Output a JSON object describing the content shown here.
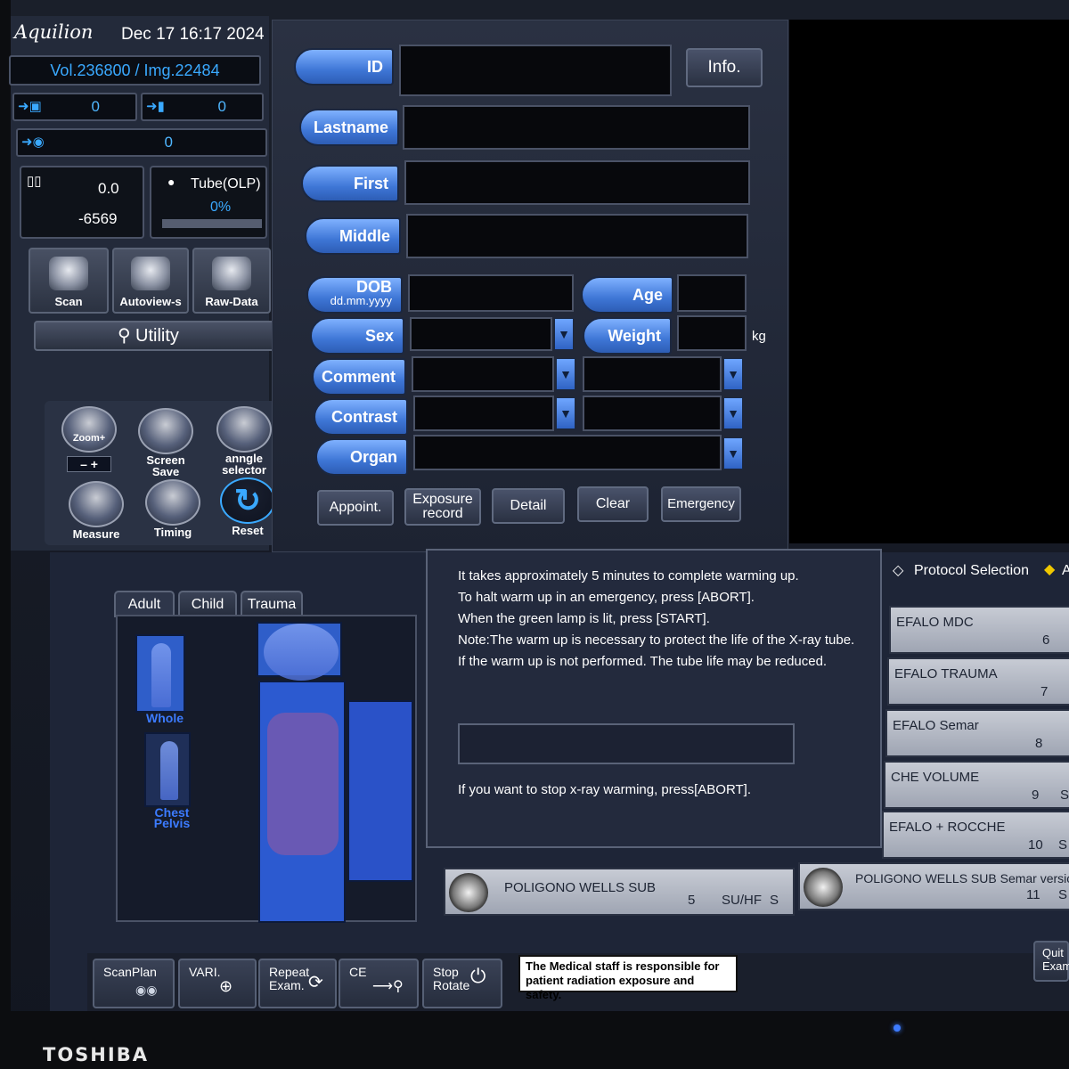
{
  "monitor": {
    "brand": "TOSHIBA"
  },
  "header": {
    "logo": "Aquilion",
    "datetime": "Dec 17 16:17 2024"
  },
  "status": {
    "vol_img": "Vol.236800  / Img.22484",
    "printer_count": "0",
    "archive_count": "0",
    "disk_count": "0",
    "table_height": "0.0",
    "table_position": "-6569",
    "tube_label": "Tube(OLP)",
    "tube_percent": "0%"
  },
  "quick_buttons": {
    "scan": "Scan",
    "autoview": "Autoview-s",
    "rawdata": "Raw-Data",
    "utility": "Utility"
  },
  "tools": {
    "zoom": "Zoom+",
    "zoom_controls": "–  +",
    "screen_save_1": "Screen",
    "screen_save_2": "Save",
    "angle_1": "anngle",
    "angle_2": "selector",
    "measure": "Measure",
    "timing": "Timing",
    "reset": "Reset"
  },
  "patient_form": {
    "id": "ID",
    "info": "Info.",
    "lastname": "Lastname",
    "first": "First",
    "middle": "Middle",
    "dob": "DOB",
    "dob_format": "dd.mm.yyyy",
    "age": "Age",
    "sex": "Sex",
    "weight": "Weight",
    "weight_unit": "kg",
    "comment": "Comment",
    "contrast": "Contrast",
    "organ": "Organ"
  },
  "form_buttons": {
    "appoint": "Appoint.",
    "exposure_1": "Exposure",
    "exposure_2": "record",
    "detail": "Detail",
    "clear": "Clear",
    "emergency": "Emergency"
  },
  "anatomy_tabs": {
    "adult": "Adult",
    "child": "Child",
    "trauma": "Trauma"
  },
  "presets": {
    "whole": "Whole",
    "chest": "Chest",
    "pelvis": "Pelvis"
  },
  "warmup_dialog": {
    "line1": "It takes approximately 5 minutes to complete warming up.",
    "line2": "To halt warm up in an emergency, press [ABORT].",
    "line3": "When the green lamp is lit, press [START].",
    "line4": "Note:The warm up is necessary to protect the life of the X-ray tube.",
    "line5": "If the warm up is not performed. The tube life may be reduced.",
    "footer": "If you want to stop x-ray warming, press[ABORT]."
  },
  "protocols": {
    "header": "Protocol Selection",
    "header_right": "A",
    "items": [
      {
        "name": "EFALO MDC",
        "num": "6"
      },
      {
        "name": "EFALO TRAUMA",
        "num": "7"
      },
      {
        "name": "EFALO Semar",
        "num": "8"
      },
      {
        "name": "CHE VOLUME",
        "num": "9",
        "suffix": "S"
      },
      {
        "name": "EFALO + ROCCHE",
        "num": "10",
        "suffix": "S"
      }
    ],
    "bottom_left": {
      "name": "POLIGONO WELLS SUB",
      "num": "5",
      "mode": "SU/HF",
      "suffix": "S"
    },
    "bottom_right": {
      "name": "POLIGONO WELLS SUB Semar versione",
      "num": "11",
      "suffix": "S"
    }
  },
  "taskbar": {
    "scanplan": "ScanPlan",
    "vari": "VARI.",
    "repeat_1": "Repeat",
    "repeat_2": "Exam.",
    "ce": "CE",
    "stop_1": "Stop",
    "stop_2": "Rotate",
    "notice_1": "The Medical staff is responsible for",
    "notice_2": "patient radiation exposure and safety.",
    "quit_1": "Quit",
    "quit_2": "Exam"
  }
}
